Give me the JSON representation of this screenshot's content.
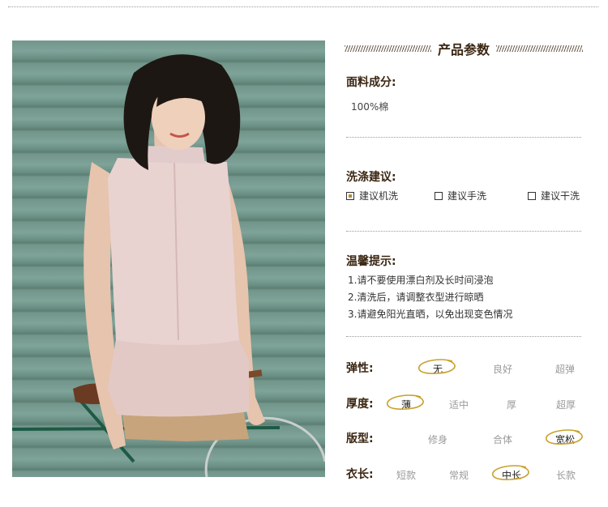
{
  "section_title": "产品参数",
  "fabric": {
    "label": "面料成分:",
    "value": "100%棉"
  },
  "wash": {
    "label": "洗涤建议:",
    "options": [
      {
        "text": "建议机洗",
        "checked": true
      },
      {
        "text": "建议手洗",
        "checked": false
      },
      {
        "text": "建议干洗",
        "checked": false
      }
    ]
  },
  "tips": {
    "label": "温馨提示:",
    "items": [
      "1.请不要使用漂白剂及长时间浸泡",
      "2.清洗后，请调整衣型进行晾晒",
      "3.请避免阳光直晒，以免出现变色情况"
    ]
  },
  "attributes": [
    {
      "label": "弹性:",
      "options": [
        "无",
        "良好",
        "超弹"
      ],
      "selected": "无"
    },
    {
      "label": "厚度:",
      "options": [
        "薄",
        "适中",
        "厚",
        "超厚"
      ],
      "selected": "薄"
    },
    {
      "label": "版型:",
      "options": [
        "修身",
        "合体",
        "宽松"
      ],
      "selected": "宽松"
    },
    {
      "label": "衣长:",
      "options": [
        "短款",
        "常规",
        "中长",
        "长款"
      ],
      "selected": "中长"
    }
  ],
  "colors": {
    "accent": "#c9a12c",
    "heading": "#3a2612",
    "muted": "#9a9a9a"
  },
  "icons": [
    "checkbox-icon",
    "highlight-ring-icon"
  ]
}
